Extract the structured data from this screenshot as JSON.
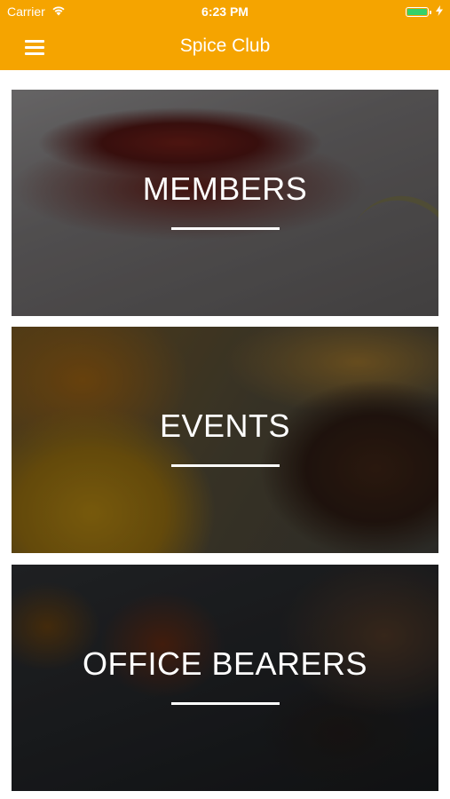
{
  "status_bar": {
    "carrier": "Carrier",
    "time": "6:23 PM",
    "wifi_icon": "wifi-icon",
    "battery_icon": "battery-icon",
    "charging_icon": "lightning-icon",
    "battery_color": "#34d16a"
  },
  "nav_bar": {
    "title": "Spice Club",
    "menu_icon": "hamburger-menu-icon",
    "background_color": "#F5A400"
  },
  "cards": [
    {
      "label": "MEMBERS",
      "background": "dried red chili peppers"
    },
    {
      "label": "EVENTS",
      "background": "turmeric and curry powder with cloves"
    },
    {
      "label": "OFFICE BEARERS",
      "background": "spices in spoons"
    }
  ]
}
